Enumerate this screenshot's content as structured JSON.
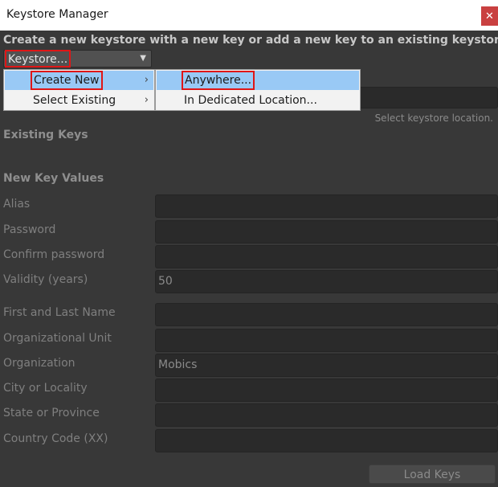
{
  "window": {
    "title": "Keystore Manager",
    "close_glyph": "✕"
  },
  "header": {
    "text": "Create a new keystore with a new key or add a new key to an existing keystore"
  },
  "keystore_popup": {
    "label": "Keystore...",
    "arrow": "▼"
  },
  "menu": {
    "items": [
      {
        "label": "Create New",
        "arrow": "›",
        "highlighted": true
      },
      {
        "label": "Select Existing",
        "arrow": "›",
        "highlighted": false
      }
    ],
    "submenu": [
      {
        "label": "Anywhere...",
        "highlighted": true
      },
      {
        "label": "In Dedicated Location...",
        "highlighted": false
      }
    ]
  },
  "location_hint": "Select keystore location.",
  "sections": {
    "existing_keys": "Existing Keys",
    "new_key_values": "New Key Values"
  },
  "fields": [
    {
      "label": "Alias",
      "value": ""
    },
    {
      "label": "Password",
      "value": ""
    },
    {
      "label": "Confirm password",
      "value": ""
    },
    {
      "label": "Validity (years)",
      "value": "50"
    },
    {
      "label": "First and Last Name",
      "value": ""
    },
    {
      "label": "Organizational Unit",
      "value": ""
    },
    {
      "label": "Organization",
      "value": "Mobics"
    },
    {
      "label": "City or Locality",
      "value": ""
    },
    {
      "label": "State or Province",
      "value": ""
    },
    {
      "label": "Country Code (XX)",
      "value": ""
    }
  ],
  "load_button": {
    "label": "Load Keys"
  },
  "colors": {
    "background": "#383838",
    "highlight": "#99c9f5",
    "annotation_box": "#e01616",
    "close_button": "#c94040"
  }
}
